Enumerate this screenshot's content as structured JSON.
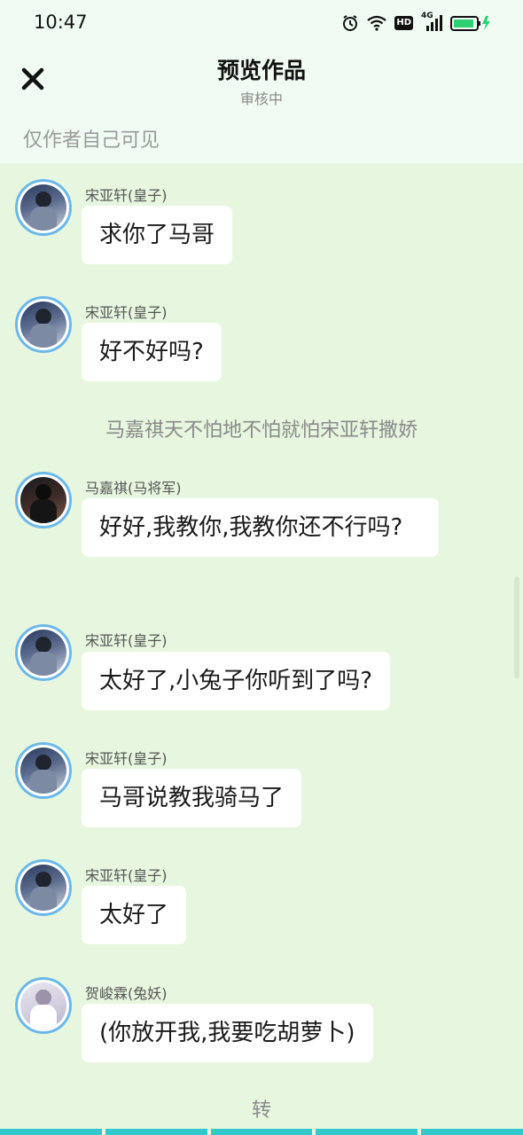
{
  "status_bar": {
    "time": "10:47",
    "icons": [
      "alarm-icon",
      "wifi-icon",
      "hd-icon",
      "4g-signal-icon",
      "battery-charging-icon"
    ],
    "hd_label": "HD",
    "network_label": "4G"
  },
  "header": {
    "title": "预览作品",
    "subtitle": "审核中",
    "visibility_note": "仅作者自己可见",
    "close_icon": "close-icon"
  },
  "messages": [
    {
      "type": "message",
      "sender": "宋亚轩(皇子)",
      "avatar": "song",
      "text": "求你了马哥"
    },
    {
      "type": "message",
      "sender": "宋亚轩(皇子)",
      "avatar": "song",
      "text": "好不好吗?"
    },
    {
      "type": "narration",
      "text": "马嘉祺天不怕地不怕就怕宋亚轩撒娇"
    },
    {
      "type": "message",
      "sender": "马嘉祺(马将军)",
      "avatar": "ma",
      "text": "好好,我教你,我教你还不行吗?"
    },
    {
      "type": "message",
      "sender": "宋亚轩(皇子)",
      "avatar": "song",
      "text": "太好了,小兔子你听到了吗?"
    },
    {
      "type": "message",
      "sender": "宋亚轩(皇子)",
      "avatar": "song",
      "text": "马哥说教我骑马了"
    },
    {
      "type": "message",
      "sender": "宋亚轩(皇子)",
      "avatar": "song",
      "text": "太好了"
    },
    {
      "type": "message",
      "sender": "贺峻霖(兔妖)",
      "avatar": "he",
      "text": "(你放开我,我要吃胡萝卜)"
    }
  ],
  "footer": {
    "label": "转"
  },
  "colors": {
    "chat_background": "#e6f6df",
    "header_background": "#f0fbf2",
    "avatar_border": "#6cb8ea",
    "bottom_accent": "#33c8cc"
  }
}
